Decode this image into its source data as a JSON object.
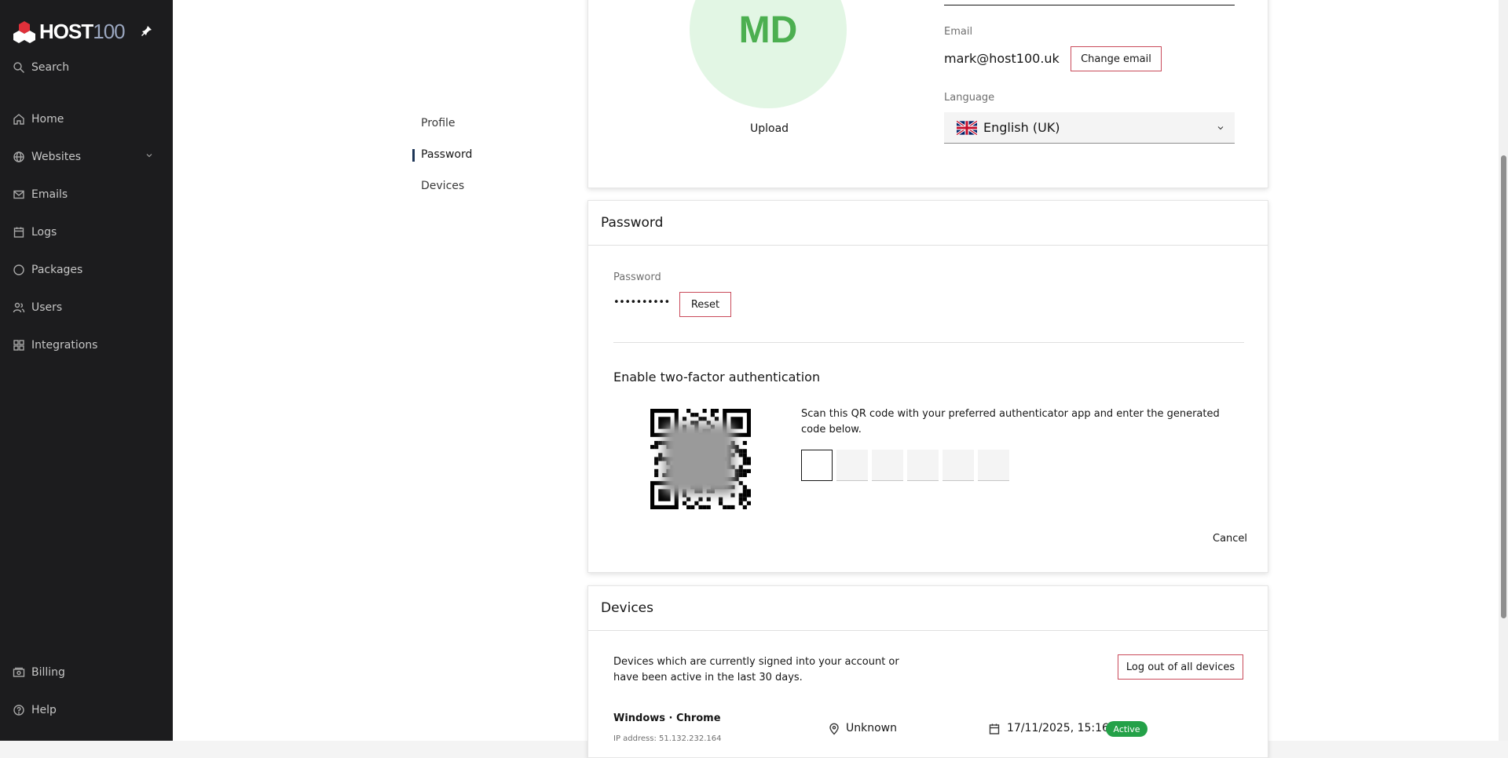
{
  "brand": {
    "name_main": "HOST",
    "name_num": "100"
  },
  "sidebar": {
    "search_label": "Search",
    "items": [
      {
        "label": "Home"
      },
      {
        "label": "Websites"
      },
      {
        "label": "Emails"
      },
      {
        "label": "Logs"
      },
      {
        "label": "Packages"
      },
      {
        "label": "Users"
      },
      {
        "label": "Integrations"
      }
    ],
    "bottom": [
      {
        "label": "Billing"
      },
      {
        "label": "Help"
      }
    ]
  },
  "subnav": {
    "profile": "Profile",
    "password": "Password",
    "devices": "Devices",
    "active": "Password"
  },
  "profile": {
    "initials": "MD",
    "upload": "Upload",
    "email_label": "Email",
    "email": "mark@host100.uk",
    "change_email": "Change email",
    "language_label": "Language",
    "language": "English (UK)"
  },
  "password_card": {
    "title": "Password",
    "password_label": "Password",
    "password_mask": "••••••••••",
    "reset": "Reset",
    "twofa_title": "Enable two-factor authentication",
    "twofa_instructions": "Scan this QR code with your preferred authenticator app and enter the generated code below.",
    "code_length": 6,
    "cancel": "Cancel"
  },
  "devices_card": {
    "title": "Devices",
    "description": "Devices which are currently signed into your account or have been active in the last 30 days.",
    "logout_all": "Log out of all devices",
    "device": {
      "name": "Windows · Chrome",
      "ip": "IP address: 51.132.232.164",
      "location": "Unknown",
      "date": "17/11/2025, 15:16",
      "status": "Active"
    }
  },
  "colors": {
    "sidebar_bg": "#1c1c1e",
    "accent_border": "#c94a5a",
    "avatar_bg": "#e2f6e4",
    "avatar_text": "#4caf50",
    "active_badge": "#24a148"
  }
}
